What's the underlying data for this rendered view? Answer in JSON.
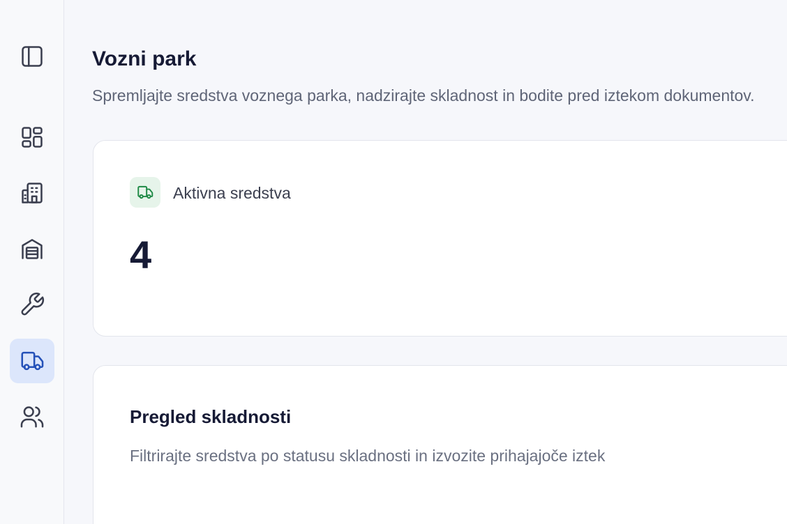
{
  "sidebar": {
    "items": [
      {
        "icon": "sidebar-toggle-icon",
        "active": false
      },
      {
        "icon": "dashboard-icon",
        "active": false
      },
      {
        "icon": "buildings-icon",
        "active": false
      },
      {
        "icon": "warehouse-icon",
        "active": false
      },
      {
        "icon": "wrench-icon",
        "active": false
      },
      {
        "icon": "truck-icon",
        "active": true
      },
      {
        "icon": "users-icon",
        "active": false
      }
    ],
    "active_color": "#2451b8",
    "active_background": "#dce6fb"
  },
  "page": {
    "title": "Vozni park",
    "subtitle": "Spremljajte sredstva voznega parka, nadzirajte skladnost in bodite pred iztekom dokumentov."
  },
  "stats": {
    "active_assets": {
      "label": "Aktivna sredstva",
      "value": "4",
      "icon": "truck-icon",
      "icon_color": "#1f8a46",
      "icon_background": "#e6f4ea"
    }
  },
  "compliance": {
    "title": "Pregled skladnosti",
    "description": "Filtrirajte sredstva po statusu skladnosti in izvozite prihajajoče iztek"
  }
}
